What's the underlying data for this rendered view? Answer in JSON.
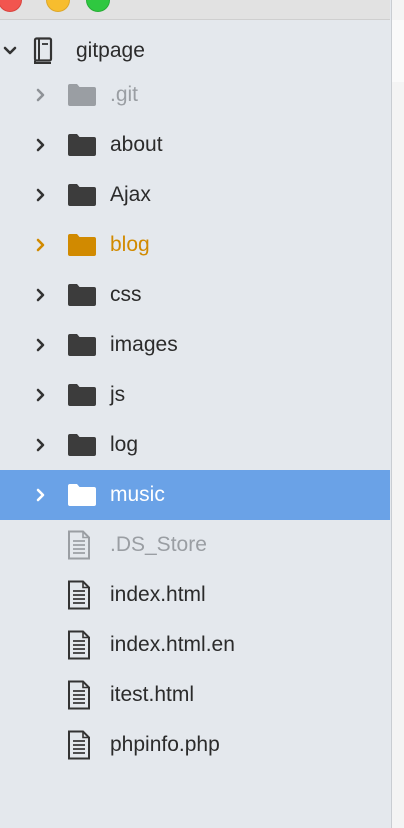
{
  "colors": {
    "sidebar_bg": "#e4e8ed",
    "selection": "#6aa2e7",
    "folder_dark": "#3c3c3c",
    "folder_muted": "#9a9ea3",
    "folder_orange": "#d18a00",
    "text": "#2b2b2b"
  },
  "tree": {
    "root": {
      "label": "gitpage",
      "icon": "book-icon",
      "expanded": true
    },
    "items": [
      {
        "label": ".git",
        "type": "folder",
        "state": "muted"
      },
      {
        "label": "about",
        "type": "folder",
        "state": "normal"
      },
      {
        "label": "Ajax",
        "type": "folder",
        "state": "normal"
      },
      {
        "label": "blog",
        "type": "folder",
        "state": "modified"
      },
      {
        "label": "css",
        "type": "folder",
        "state": "normal"
      },
      {
        "label": "images",
        "type": "folder",
        "state": "normal"
      },
      {
        "label": "js",
        "type": "folder",
        "state": "normal"
      },
      {
        "label": "log",
        "type": "folder",
        "state": "normal"
      },
      {
        "label": "music",
        "type": "folder",
        "state": "selected"
      },
      {
        "label": ".DS_Store",
        "type": "file",
        "state": "muted"
      },
      {
        "label": "index.html",
        "type": "file",
        "state": "normal"
      },
      {
        "label": "index.html.en",
        "type": "file",
        "state": "normal"
      },
      {
        "label": "itest.html",
        "type": "file",
        "state": "normal"
      },
      {
        "label": "phpinfo.php",
        "type": "file",
        "state": "normal"
      }
    ]
  }
}
